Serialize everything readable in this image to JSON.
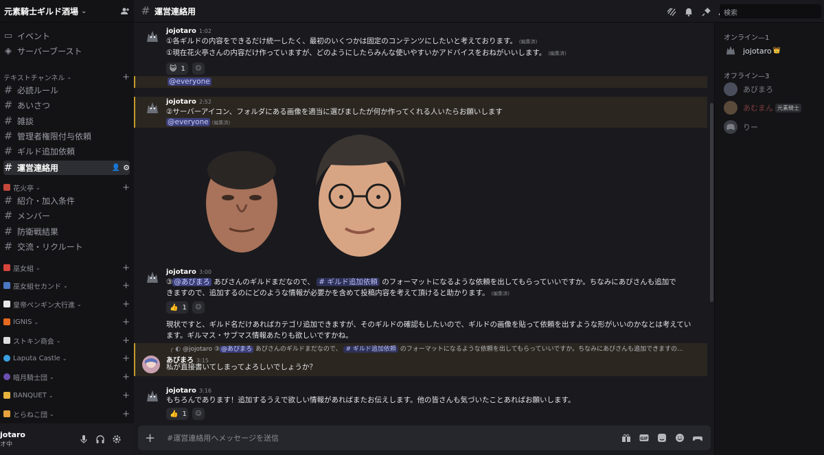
{
  "server": {
    "name": "元素騎士ギルド酒場"
  },
  "sidebar": {
    "top_items": [
      {
        "label": "イベント",
        "icon": "calendar-icon"
      },
      {
        "label": "サーバーブースト",
        "icon": "boost-icon"
      }
    ],
    "text_category": "テキストチャンネル",
    "channels": [
      "必読ルール",
      "あいさつ",
      "雑談",
      "管理者権限付与依頼",
      "ギルド追加依頼",
      "運営連絡用"
    ],
    "category2": "花火亭",
    "channels2": [
      "紹介・加入条件",
      "メンバー",
      "防衛戦結果",
      "交流・リクルート"
    ],
    "categories": [
      "巫女組",
      "巫女組セカンド",
      "皇帝ペンギン大行進",
      "IGNIS",
      "ストキン商会",
      "Laputa Castle",
      "暗月騎士団",
      "BANQUET",
      "とらねこ団"
    ]
  },
  "user_panel": {
    "name": "jotaro",
    "status": "オ中"
  },
  "topbar": {
    "channel": "運営連絡用",
    "search_placeholder": "検索"
  },
  "messages": {
    "m1": {
      "author": "jojotaro",
      "time": "1:02",
      "line1": "①各ギルドの内容をできるだけ統一したく、最初のいくつかは固定のコンテンツにしたいと考えております。",
      "line2": "①現在花火亭さんの内容だけ作っていますが、どのようにしたらみんな使いやすいかアドバイスをおねがいいします。",
      "edited": "(編集済)",
      "reaction_count": "1"
    },
    "m_everyone": {
      "mention": "@everyone"
    },
    "m2": {
      "author": "jojotaro",
      "time": "2:52",
      "line1": "②サーバーアイコン、フォルダにある画像を適当に選びましたが何か作ってくれる人いたらお願いします",
      "mention": "@everyone",
      "edited": "(編集済)"
    },
    "m3": {
      "author": "jojotaro",
      "time": "3:00",
      "prefix": "③",
      "mention": "@あびまろ",
      "text_a": "あびさんのギルドまだなので、",
      "channel": "# ギルド追加依頼",
      "text_b": "のフォーマットになるような依頼を出してもらっていいですか。ちなみにあびさんも追加で",
      "line2": "きますので、追加するのにどのような情報が必要かを含めて投稿内容を考えて頂けると助かります。",
      "edited": "(編集済)",
      "reaction_count": "1",
      "follow1": "現状ですと、ギルド名だけあればカテゴリ追加できますが、そのギルドの確認もしたいので、ギルドの画像を貼って依頼を出すような形がいいのかなとは考えてい",
      "follow2": "ます。ギルマス・サブマス情報あたりも欲しいですかね。"
    },
    "m4": {
      "reply_author": "@jojotaro",
      "reply_prefix": "③",
      "reply_mention": "@あびまろ",
      "reply_text_a": "あびさんのギルドまだなので、",
      "reply_channel": "# ギルド追加依頼",
      "reply_text_b": "のフォーマットになるような依頼を出してもらっていいですか。ちなみにあびさんも追加できますの...",
      "author": "あびまろ",
      "time": "3:15",
      "line1": "私が直接書いてしまってよろしいでしょうか？"
    },
    "m5": {
      "author": "jojotaro",
      "time": "3:16",
      "line1": "もちろんであります！追加するうえで欲しい情報があればまたお伝えします。他の皆さんも気づいたことあればお願いします。",
      "reaction_count": "1"
    }
  },
  "composer": {
    "placeholder": "#運営連絡用へメッセージを送信"
  },
  "members": {
    "online_header": "オンライン—1",
    "online": [
      {
        "name": "jojotaro",
        "badge": "👑"
      }
    ],
    "offline_header": "オフライン—3",
    "offline": [
      {
        "name": "あびまろ"
      },
      {
        "name": "あむまん",
        "tag": "元素騎士"
      },
      {
        "name": "りー"
      }
    ]
  },
  "colors": {
    "accent": "#c79c2b",
    "mention_bg": "#3b3f7a",
    "name_red": "#7a3b3b"
  }
}
